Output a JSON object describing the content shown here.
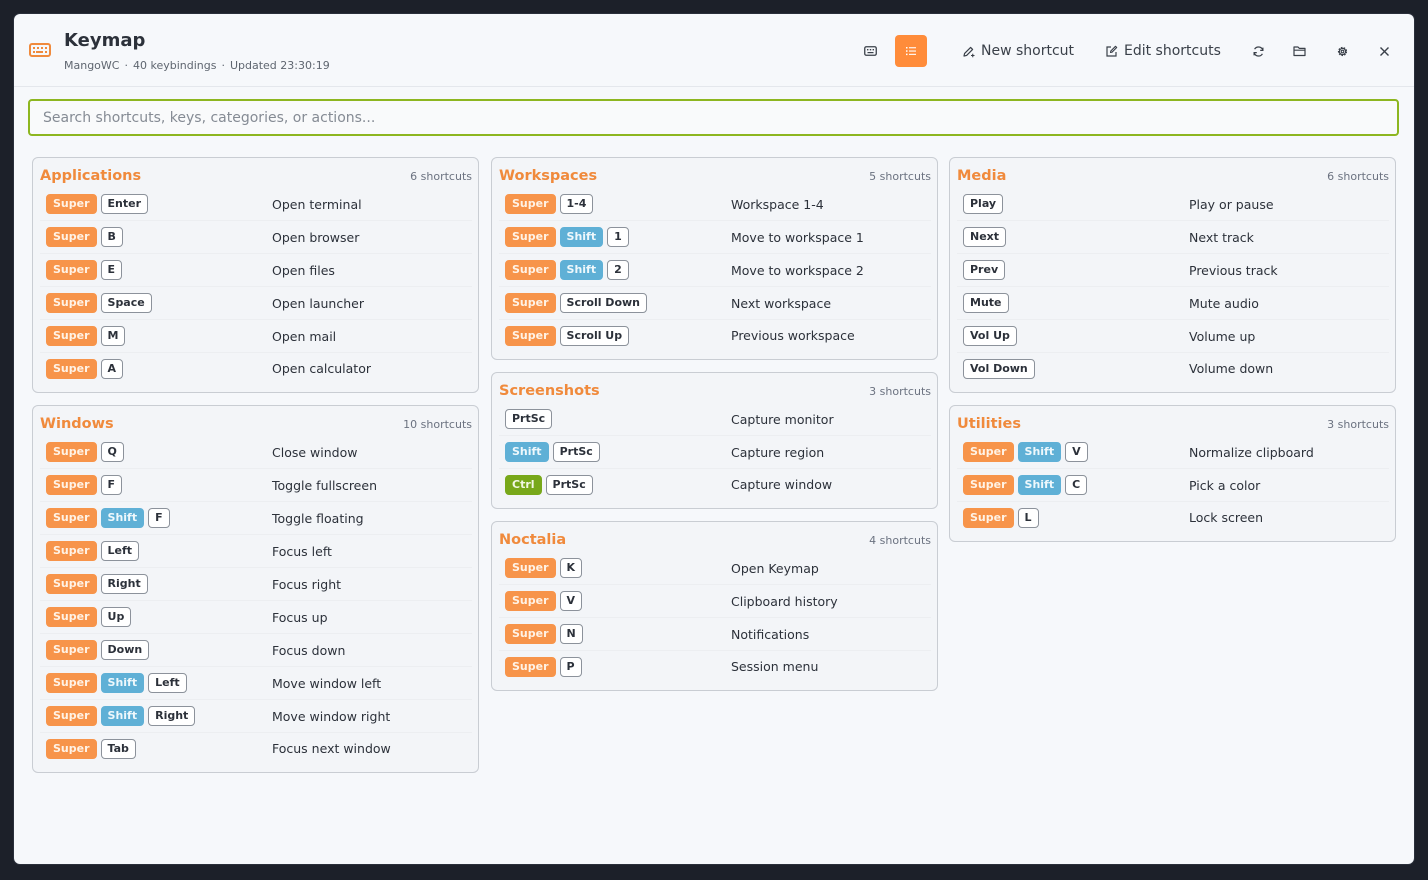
{
  "app": {
    "title": "Keymap",
    "compositor": "MangoWC",
    "keybinding_count": "40 keybindings",
    "updated": "Updated 23:30:19",
    "separator": "·"
  },
  "toolbar": {
    "new_shortcut": "New shortcut",
    "edit_shortcuts": "Edit shortcuts",
    "active_view": "list"
  },
  "search": {
    "placeholder": "Search shortcuts, keys, categories, or actions..."
  },
  "colors": {
    "accent": "#f08a3c",
    "super": "#f7944a",
    "shift": "#5fb0d6",
    "ctrl": "#78a81a",
    "search_border": "#8db620"
  },
  "columns": [
    {
      "categories": [
        {
          "title": "Applications",
          "count": "6 shortcuts",
          "rows": [
            {
              "keys": [
                "Super",
                "Enter"
              ],
              "action": "Open terminal"
            },
            {
              "keys": [
                "Super",
                "B"
              ],
              "action": "Open browser"
            },
            {
              "keys": [
                "Super",
                "E"
              ],
              "action": "Open files"
            },
            {
              "keys": [
                "Super",
                "Space"
              ],
              "action": "Open launcher"
            },
            {
              "keys": [
                "Super",
                "M"
              ],
              "action": "Open mail"
            },
            {
              "keys": [
                "Super",
                "A"
              ],
              "action": "Open calculator"
            }
          ]
        },
        {
          "title": "Windows",
          "count": "10 shortcuts",
          "rows": [
            {
              "keys": [
                "Super",
                "Q"
              ],
              "action": "Close window"
            },
            {
              "keys": [
                "Super",
                "F"
              ],
              "action": "Toggle fullscreen"
            },
            {
              "keys": [
                "Super",
                "Shift",
                "F"
              ],
              "action": "Toggle floating"
            },
            {
              "keys": [
                "Super",
                "Left"
              ],
              "action": "Focus left"
            },
            {
              "keys": [
                "Super",
                "Right"
              ],
              "action": "Focus right"
            },
            {
              "keys": [
                "Super",
                "Up"
              ],
              "action": "Focus up"
            },
            {
              "keys": [
                "Super",
                "Down"
              ],
              "action": "Focus down"
            },
            {
              "keys": [
                "Super",
                "Shift",
                "Left"
              ],
              "action": "Move window left"
            },
            {
              "keys": [
                "Super",
                "Shift",
                "Right"
              ],
              "action": "Move window right"
            },
            {
              "keys": [
                "Super",
                "Tab"
              ],
              "action": "Focus next window"
            }
          ]
        }
      ]
    },
    {
      "categories": [
        {
          "title": "Workspaces",
          "count": "5 shortcuts",
          "rows": [
            {
              "keys": [
                "Super",
                "1-4"
              ],
              "action": "Workspace 1-4"
            },
            {
              "keys": [
                "Super",
                "Shift",
                "1"
              ],
              "action": "Move to workspace 1"
            },
            {
              "keys": [
                "Super",
                "Shift",
                "2"
              ],
              "action": "Move to workspace 2"
            },
            {
              "keys": [
                "Super",
                "Scroll Down"
              ],
              "action": "Next workspace"
            },
            {
              "keys": [
                "Super",
                "Scroll Up"
              ],
              "action": "Previous workspace"
            }
          ]
        },
        {
          "title": "Screenshots",
          "count": "3 shortcuts",
          "rows": [
            {
              "keys": [
                "PrtSc"
              ],
              "action": "Capture monitor"
            },
            {
              "keys": [
                "Shift",
                "PrtSc"
              ],
              "action": "Capture region"
            },
            {
              "keys": [
                "Ctrl",
                "PrtSc"
              ],
              "action": "Capture window"
            }
          ]
        },
        {
          "title": "Noctalia",
          "count": "4 shortcuts",
          "rows": [
            {
              "keys": [
                "Super",
                "K"
              ],
              "action": "Open Keymap"
            },
            {
              "keys": [
                "Super",
                "V"
              ],
              "action": "Clipboard history"
            },
            {
              "keys": [
                "Super",
                "N"
              ],
              "action": "Notifications"
            },
            {
              "keys": [
                "Super",
                "P"
              ],
              "action": "Session menu"
            }
          ]
        }
      ]
    },
    {
      "categories": [
        {
          "title": "Media",
          "count": "6 shortcuts",
          "rows": [
            {
              "keys": [
                "Play"
              ],
              "action": "Play or pause"
            },
            {
              "keys": [
                "Next"
              ],
              "action": "Next track"
            },
            {
              "keys": [
                "Prev"
              ],
              "action": "Previous track"
            },
            {
              "keys": [
                "Mute"
              ],
              "action": "Mute audio"
            },
            {
              "keys": [
                "Vol Up"
              ],
              "action": "Volume up"
            },
            {
              "keys": [
                "Vol Down"
              ],
              "action": "Volume down"
            }
          ]
        },
        {
          "title": "Utilities",
          "count": "3 shortcuts",
          "rows": [
            {
              "keys": [
                "Super",
                "Shift",
                "V"
              ],
              "action": "Normalize clipboard"
            },
            {
              "keys": [
                "Super",
                "Shift",
                "C"
              ],
              "action": "Pick a color"
            },
            {
              "keys": [
                "Super",
                "L"
              ],
              "action": "Lock screen"
            }
          ]
        }
      ]
    }
  ]
}
